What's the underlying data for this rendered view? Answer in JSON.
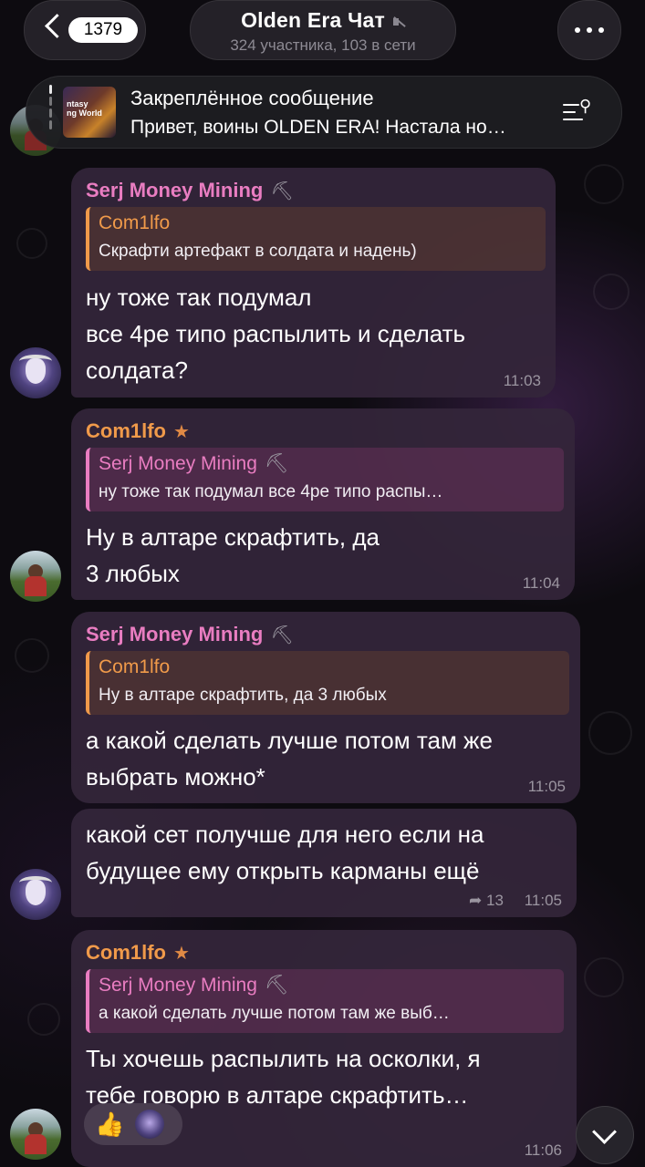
{
  "header": {
    "back_count": "1379",
    "title": "Olden Era Чат",
    "subtitle": "324 участника, 103 в сети"
  },
  "pinned": {
    "title": "Закреплённое сообщение",
    "text": "Привет, воины OLDEN ERA! Настала но…",
    "thumb_text": "ntasy\nng World"
  },
  "messages": [
    {
      "sender": "Serj Money Mining",
      "sender_icon": "⛏",
      "reply_name": "Com1lfo",
      "reply_text": "Скрафти артефакт в солдата и надень)",
      "lines": [
        "ну тоже так подумал",
        "все 4ре типо распылить и сделать",
        "солдата?"
      ],
      "time": "11:03"
    },
    {
      "sender": "Com1lfo",
      "sender_icon": "★",
      "reply_name": "Serj Money Mining",
      "reply_icon": "⛏",
      "reply_text": "ну тоже так подумал все 4ре типо распы…",
      "lines": [
        "Ну в алтаре скрафтить, да",
        "3 любых"
      ],
      "time": "11:04"
    },
    {
      "sender": "Serj Money Mining",
      "sender_icon": "⛏",
      "reply_name": "Com1lfo",
      "reply_text": "Ну в алтаре скрафтить, да 3 любых",
      "lines": [
        "а какой сделать лучше потом там же",
        "выбрать можно*"
      ],
      "time": "11:05"
    },
    {
      "lines": [
        "какой сет получше для него если на",
        "будущее ему открыть карманы ещё"
      ],
      "reply_count": "13",
      "time": "11:05"
    },
    {
      "sender": "Com1lfo",
      "sender_icon": "★",
      "reply_name": "Serj Money Mining",
      "reply_icon": "⛏",
      "reply_text": "а какой сделать лучше потом там же выб…",
      "lines": [
        "Ты хочешь распылить на осколки, я",
        "тебе говорю в алтаре скрафтить…"
      ],
      "reaction": "👍",
      "time": "11:06"
    }
  ],
  "colors": {
    "accent_pink": "#e97dc1",
    "accent_orange": "#f09a4a",
    "bubble": "#34263a"
  }
}
